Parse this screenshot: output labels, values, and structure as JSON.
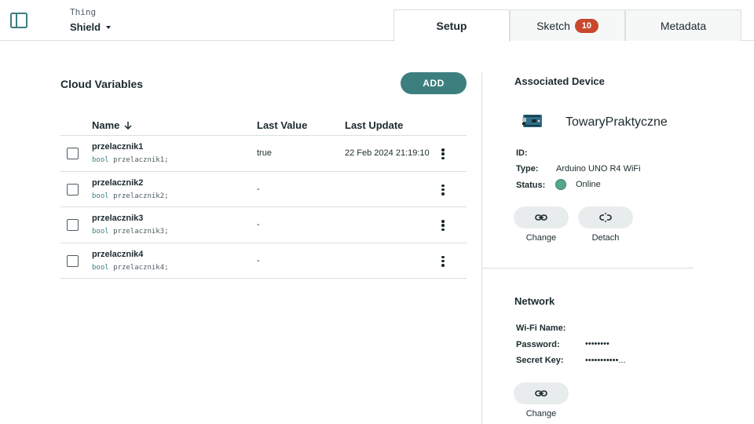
{
  "header": {
    "thing_label": "Thing",
    "thing_name": "Shield",
    "tabs": [
      {
        "label": "Setup",
        "active": true
      },
      {
        "label": "Sketch",
        "badge": "10",
        "active": false
      },
      {
        "label": "Metadata",
        "active": false
      }
    ]
  },
  "cloud_variables": {
    "title": "Cloud Variables",
    "add_label": "ADD",
    "columns": {
      "name": "Name",
      "last_value": "Last Value",
      "last_update": "Last Update"
    },
    "rows": [
      {
        "name": "przelacznik1",
        "type": "bool",
        "decl": "przelacznik1;",
        "value": "true",
        "update": "22 Feb 2024 21:19:10"
      },
      {
        "name": "przelacznik2",
        "type": "bool",
        "decl": "przelacznik2;",
        "value": "-",
        "update": ""
      },
      {
        "name": "przelacznik3",
        "type": "bool",
        "decl": "przelacznik3;",
        "value": "-",
        "update": ""
      },
      {
        "name": "przelacznik4",
        "type": "bool",
        "decl": "przelacznik4;",
        "value": "-",
        "update": ""
      }
    ]
  },
  "associated_device": {
    "title": "Associated Device",
    "device_name": "TowaryPraktyczne",
    "id_label": "ID:",
    "id_value": "",
    "type_label": "Type:",
    "type_value": "Arduino UNO R4 WiFi",
    "status_label": "Status:",
    "status_value": "Online",
    "status_color": "#58a68b",
    "change_label": "Change",
    "detach_label": "Detach"
  },
  "network": {
    "title": "Network",
    "wifi_label": "Wi-Fi Name:",
    "wifi_value": "",
    "password_label": "Password:",
    "password_value": "••••••••",
    "secret_label": "Secret Key:",
    "secret_value": "•••••••••••...",
    "change_label": "Change"
  },
  "colors": {
    "accent": "#3d7f7f",
    "badge": "#c9482d",
    "border": "#dadfe0"
  }
}
